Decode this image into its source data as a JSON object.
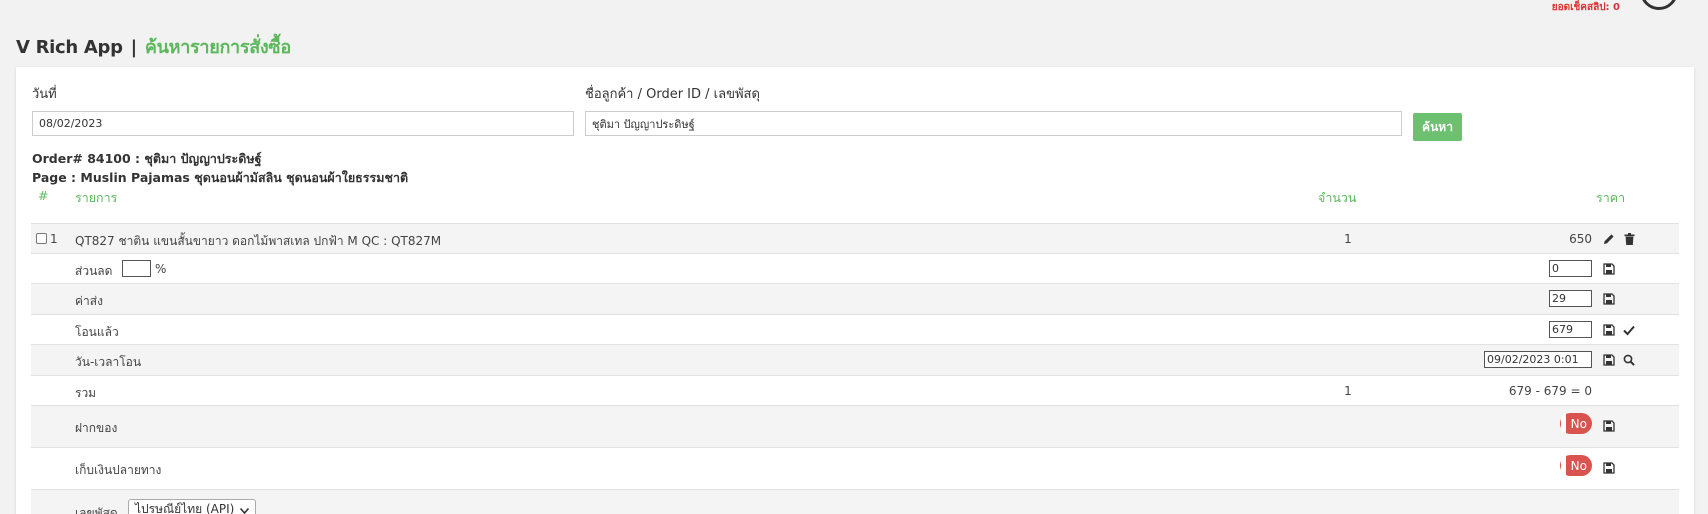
{
  "header": {
    "status_text": "ยอดเช็คสลิป: 0",
    "app_name": "V Rich App",
    "separator": "|",
    "page_name": "ค้นหารายการสั่งซื้อ"
  },
  "search": {
    "date_label": "วันที่",
    "date_value": "08/02/2023",
    "query_label": "ชื่อลูกค้า / Order ID / เลขพัสดุ",
    "query_value": "ชุติมา ปัญญาประดิษฐ์",
    "search_button": "ค้นหา"
  },
  "order": {
    "order_line": "Order# 84100 : ชุติมา ปัญญาประดิษฐ์",
    "page_line": "Page : Muslin Pajamas ชุดนอนผ้ามัสลิน ชุดนอนผ้าใยธรรมชาติ"
  },
  "table": {
    "headers": {
      "num": "#",
      "item": "รายการ",
      "qty": "จำนวน",
      "price": "ราคา"
    },
    "item": {
      "index": "1",
      "name": "QT827 ชาติน แขนสั้นขายาว ดอกไม้พาสเทล ปกฟ้า M QC : QT827M",
      "qty": "1",
      "price": "650"
    },
    "discount": {
      "label": "ส่วนลด",
      "percent_value": "",
      "percent_sign": "%",
      "value": "0"
    },
    "shipping": {
      "label": "ค่าส่ง",
      "value": "29"
    },
    "transferred": {
      "label": "โอนแล้ว",
      "value": "679"
    },
    "transfer_time": {
      "label": "วัน-เวลาโอน",
      "value": "09/02/2023 0:01"
    },
    "total": {
      "label": "รวม",
      "qty": "1",
      "summary": "679 - 679 = 0"
    },
    "deposit": {
      "label": "ฝากของ",
      "toggle": "No"
    },
    "cod": {
      "label": "เก็บเงินปลายทาง",
      "toggle": "No"
    },
    "tracking": {
      "label": "เลขพัสดุ",
      "carrier": "ไปรษณีย์ไทย (API)"
    }
  },
  "colors": {
    "accent": "#5cb85c",
    "danger": "#d9534f"
  }
}
